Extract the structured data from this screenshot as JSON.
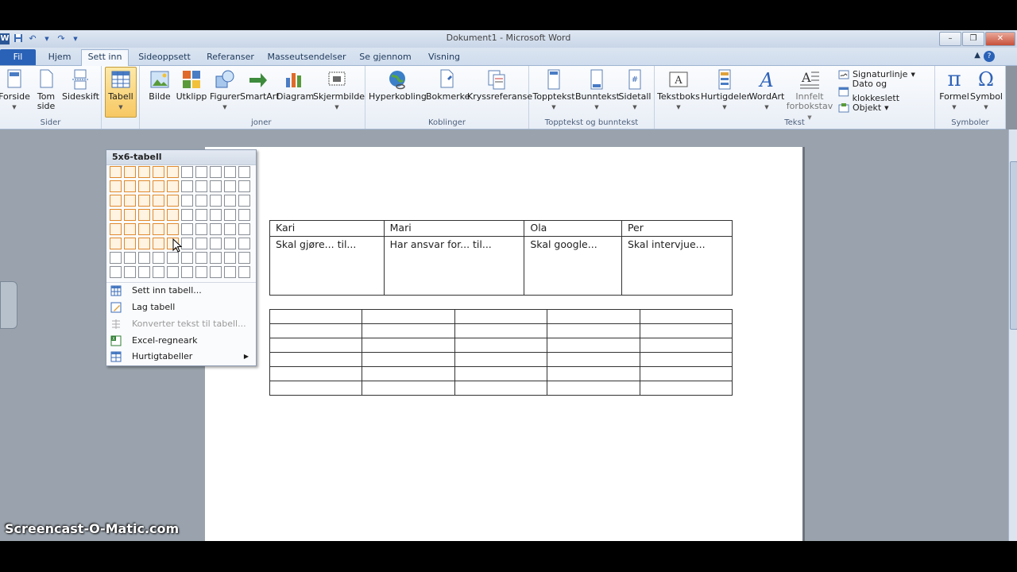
{
  "window": {
    "title": "Dokument1 - Microsoft Word",
    "logo": "W"
  },
  "qat": {
    "icons": [
      "save-icon",
      "undo-icon",
      "redo-icon",
      "customize-icon"
    ]
  },
  "tabs": [
    "Fil",
    "Hjem",
    "Sett inn",
    "Sideoppsett",
    "Referanser",
    "Masseutsendelser",
    "Se gjennom",
    "Visning"
  ],
  "active_tab": "Sett inn",
  "ribbon": {
    "sider": {
      "label": "Sider",
      "buttons": [
        "Forside",
        "Tom side",
        "Sideskift"
      ],
      "tom": "Tom",
      "side": "side"
    },
    "tabeller": {
      "label": "Tabell"
    },
    "illustrasjoner": {
      "label_partial": "joner",
      "buttons": [
        "Bilde",
        "Utklipp",
        "Figurer",
        "SmartArt",
        "Diagram",
        "Skjermbilde"
      ]
    },
    "koblinger": {
      "label": "Koblinger",
      "buttons": [
        "Hyperkobling",
        "Bokmerke",
        "Kryssreferanse"
      ]
    },
    "topptekst": {
      "label": "Topptekst og bunntekst",
      "buttons": [
        "Topptekst",
        "Bunntekst",
        "Sidetall"
      ]
    },
    "tekst": {
      "label": "Tekst",
      "buttons": [
        "Tekstboks",
        "Hurtigdeler",
        "WordArt"
      ],
      "innfelt_1": "Innfelt",
      "innfelt_2": "forbokstav",
      "small": [
        "Signaturlinje",
        "Dato og klokkeslett",
        "Objekt"
      ]
    },
    "symboler": {
      "label": "Symboler",
      "buttons": [
        "Formel",
        "Symbol"
      ]
    }
  },
  "dropdown": {
    "title": "5x6-tabell",
    "grid": {
      "cols": 10,
      "rows": 8,
      "sel_cols": 5,
      "sel_rows": 6
    },
    "items": [
      {
        "label": "Sett inn tabell...",
        "icon": "table-icon",
        "disabled": false
      },
      {
        "label": "Lag tabell",
        "icon": "draw-table-icon",
        "disabled": false
      },
      {
        "label": "Konverter tekst til tabell...",
        "icon": "convert-icon",
        "disabled": true
      },
      {
        "label": "Excel-regneark",
        "icon": "excel-icon",
        "disabled": false
      },
      {
        "label": "Hurtigtabeller",
        "icon": "quick-table-icon",
        "disabled": false,
        "submenu": true
      }
    ]
  },
  "document": {
    "table1": {
      "headers": [
        "Kari",
        "Mari",
        "Ola",
        "Per"
      ],
      "row2": [
        "Skal gjøre... til...",
        "Har ansvar for... til...",
        "Skal google...",
        "Skal intervjue..."
      ]
    },
    "table2": {
      "rows": 6,
      "cols": 5
    }
  },
  "watermark": "Screencast-O-Matic.com",
  "colors": {
    "accent": "#2a62b7",
    "selection": "#e08a2d",
    "ribbon_sel": "#f7c863"
  }
}
